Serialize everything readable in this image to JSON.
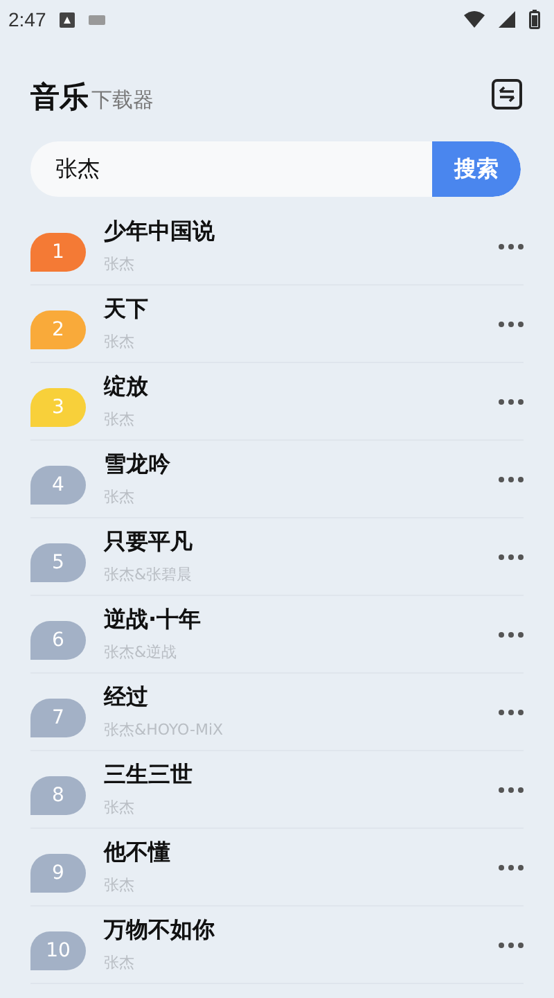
{
  "status_bar": {
    "time": "2:47"
  },
  "header": {
    "title": "音乐",
    "subtitle": "下载器"
  },
  "search": {
    "value": "张杰",
    "button": "搜索"
  },
  "songs": [
    {
      "rank": "1",
      "title": "少年中国说",
      "artist": "张杰",
      "color": "#f47a35"
    },
    {
      "rank": "2",
      "title": "天下",
      "artist": "张杰",
      "color": "#f9aa3a"
    },
    {
      "rank": "3",
      "title": "绽放",
      "artist": "张杰",
      "color": "#f8d03a"
    },
    {
      "rank": "4",
      "title": "雪龙吟",
      "artist": "张杰",
      "color": "#a3b1c6"
    },
    {
      "rank": "5",
      "title": "只要平凡",
      "artist": "张杰&张碧晨",
      "color": "#a3b1c6"
    },
    {
      "rank": "6",
      "title": "逆战·十年",
      "artist": "张杰&逆战",
      "color": "#a3b1c6"
    },
    {
      "rank": "7",
      "title": "经过",
      "artist": "张杰&HOYO-MiX",
      "color": "#a3b1c6"
    },
    {
      "rank": "8",
      "title": "三生三世",
      "artist": "张杰",
      "color": "#a3b1c6"
    },
    {
      "rank": "9",
      "title": "他不懂",
      "artist": "张杰",
      "color": "#a3b1c6"
    },
    {
      "rank": "10",
      "title": "万物不如你",
      "artist": "张杰",
      "color": "#a3b1c6"
    }
  ]
}
